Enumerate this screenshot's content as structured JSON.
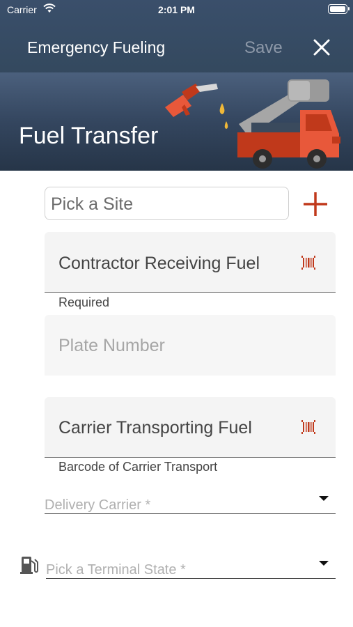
{
  "status_bar": {
    "carrier": "Carrier",
    "time": "2:01 PM"
  },
  "nav": {
    "title": "Emergency Fueling",
    "save_label": "Save",
    "close_icon": "close-icon"
  },
  "hero": {
    "title": "Fuel Transfer"
  },
  "site": {
    "placeholder": "Pick a Site"
  },
  "fields": {
    "contractor": {
      "label": "Contractor Receiving Fuel",
      "helper": "Required"
    },
    "plate": {
      "placeholder": "Plate Number"
    },
    "carrier": {
      "label": "Carrier Transporting Fuel",
      "helper": "Barcode of Carrier Transport"
    }
  },
  "selects": {
    "delivery_carrier": {
      "placeholder": "Delivery Carrier *"
    },
    "terminal_state": {
      "placeholder": "Pick a Terminal State *"
    }
  },
  "colors": {
    "accent": "#c0391b",
    "header_bg": "#34495f",
    "truck_orange": "#e8583a"
  }
}
